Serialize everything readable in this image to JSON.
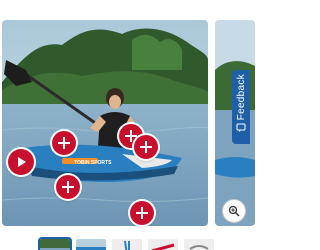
{
  "gallery": {
    "main_image_alt": "TOBIN SPORTS",
    "boat_brand": "TOBIN SPORTS",
    "hotspot_count": 6,
    "play_icon": "play-icon",
    "plus_icon": "plus-icon",
    "zoom_icon": "zoom-in-icon",
    "thumbnail_count": 5,
    "selected_thumbnail": 1
  },
  "feedback": {
    "label": "Feedback",
    "icon": "feedback-chat-icon"
  },
  "colors": {
    "accent_red": "#c8102e",
    "feedback_blue": "#1f5fa8",
    "kayak_blue": "#2a7fc0",
    "water": "#7fa7c4"
  }
}
